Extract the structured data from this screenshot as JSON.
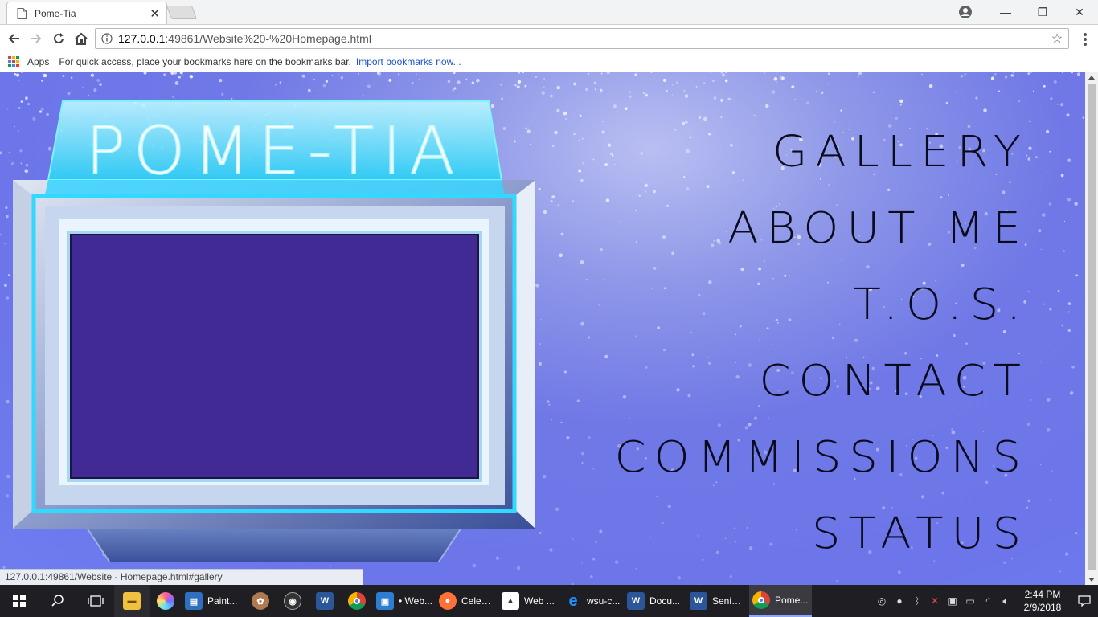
{
  "browser": {
    "tab_title": "Pome-Tia",
    "url_host": "127.0.0.1",
    "url_rest": ":49861/Website%20-%20Homepage.html",
    "bookmarks": {
      "apps_label": "Apps",
      "hint": "For quick access, place your bookmarks here on the bookmarks bar.",
      "import_link": "Import bookmarks now..."
    },
    "status_url": "127.0.0.1:49861/Website - Homepage.html#gallery"
  },
  "page": {
    "logo_text": "POME-TIA",
    "nav": [
      {
        "label": "GALLERY"
      },
      {
        "label": "ABOUT ME"
      },
      {
        "label": "T.O.S."
      },
      {
        "label": "CONTACT"
      },
      {
        "label": "COMMISSIONS"
      },
      {
        "label": "STATUS"
      }
    ],
    "colors": {
      "background": "#6f78e6",
      "screen": "#412a94",
      "frame_glow": "#2ee6ff",
      "nav_text": "#0b0b1e"
    }
  },
  "taskbar": {
    "apps": [
      {
        "label": "Paint...",
        "icon": "paint-icon",
        "color": "#2f6fbf"
      },
      {
        "label": "",
        "icon": "mushroom-icon",
        "color": "#b07a50"
      },
      {
        "label": "",
        "icon": "obs-icon",
        "color": "#333"
      },
      {
        "label": "",
        "icon": "word-icon",
        "color": "#2b579a"
      },
      {
        "label": "",
        "icon": "chrome-icon",
        "color": "#db4437"
      },
      {
        "label": "• Web...",
        "icon": "app-icon",
        "color": "#2d7dd2"
      },
      {
        "label": "Celest...",
        "icon": "firefox-icon",
        "color": "#ff7139"
      },
      {
        "label": "Web ...",
        "icon": "image-icon",
        "color": "#555"
      },
      {
        "label": "wsu-c...",
        "icon": "edge-icon",
        "color": "#0078d7"
      },
      {
        "label": "Docu...",
        "icon": "word-icon",
        "color": "#2b579a"
      },
      {
        "label": "Senior...",
        "icon": "word-icon",
        "color": "#2b579a"
      },
      {
        "label": "Pome...",
        "icon": "chrome-icon",
        "color": "#db4437"
      }
    ],
    "time": "2:44 PM",
    "date": "2/9/2018"
  }
}
